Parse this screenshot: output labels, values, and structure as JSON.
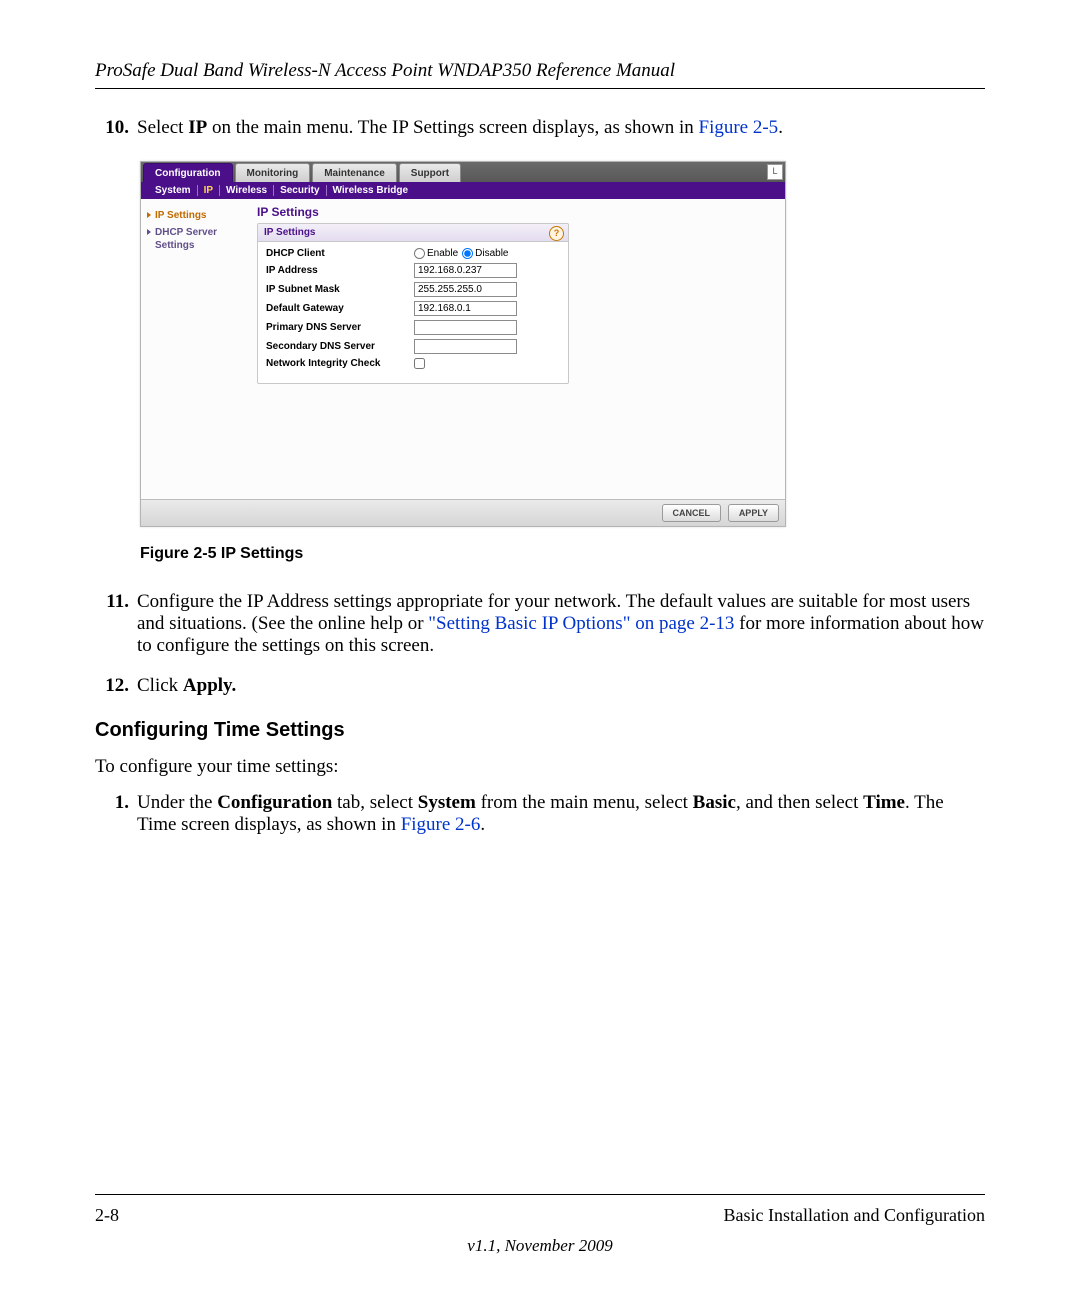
{
  "header": {
    "title": "ProSafe Dual Band Wireless-N Access Point WNDAP350 Reference Manual"
  },
  "step10": {
    "num": "10.",
    "pre": "Select ",
    "bold1": "IP",
    "post": " on the main menu. The IP Settings screen displays, as shown in ",
    "fig_link": "Figure 2-5",
    "tail": "."
  },
  "screenshot": {
    "tabs": {
      "configuration": "Configuration",
      "monitoring": "Monitoring",
      "maintenance": "Maintenance",
      "support": "Support"
    },
    "submenu": {
      "system": "System",
      "ip": "IP",
      "wireless": "Wireless",
      "security": "Security",
      "bridge": "Wireless Bridge"
    },
    "sidenav": {
      "ip_settings": "IP Settings",
      "dhcp_server": "DHCP Server Settings"
    },
    "content_title": "IP Settings",
    "panel_title": "IP Settings",
    "fields": {
      "dhcp_client": "DHCP Client",
      "enable": "Enable",
      "disable": "Disable",
      "ip_address": "IP Address",
      "ip_address_val": "192.168.0.237",
      "subnet": "IP Subnet Mask",
      "subnet_val": "255.255.255.0",
      "gateway": "Default Gateway",
      "gateway_val": "192.168.0.1",
      "pdns": "Primary DNS Server",
      "pdns_val": "",
      "sdns": "Secondary DNS Server",
      "sdns_val": "",
      "nic": "Network Integrity Check"
    },
    "buttons": {
      "cancel": "CANCEL",
      "apply": "APPLY"
    }
  },
  "fig_caption": "Figure 2-5  IP Settings",
  "step11": {
    "num": "11.",
    "line1": "Configure the IP Address settings appropriate for your network. The default values are suitable for most users and situations. (See the online help or ",
    "link": "\"Setting Basic IP Options\" on page 2-13",
    "line2": " for more information about how to configure the settings on this screen."
  },
  "step12": {
    "num": "12.",
    "pre": "Click ",
    "bold": "Apply.",
    "post": ""
  },
  "section_heading": "Configuring Time Settings",
  "time_intro": "To configure your time settings:",
  "time_step1": {
    "num": "1.",
    "p1": "Under the ",
    "b1": "Configuration",
    "p2": " tab, select ",
    "b2": "System",
    "p3": " from the main menu, select ",
    "b3": "Basic",
    "p4": ", and then select ",
    "b4": "Time",
    "p5": ". The Time screen displays, as shown in ",
    "fig_link": "Figure 2-6",
    "p6": "."
  },
  "footer": {
    "left": "2-8",
    "right": "Basic Installation and Configuration",
    "center": "v1.1, November 2009"
  }
}
